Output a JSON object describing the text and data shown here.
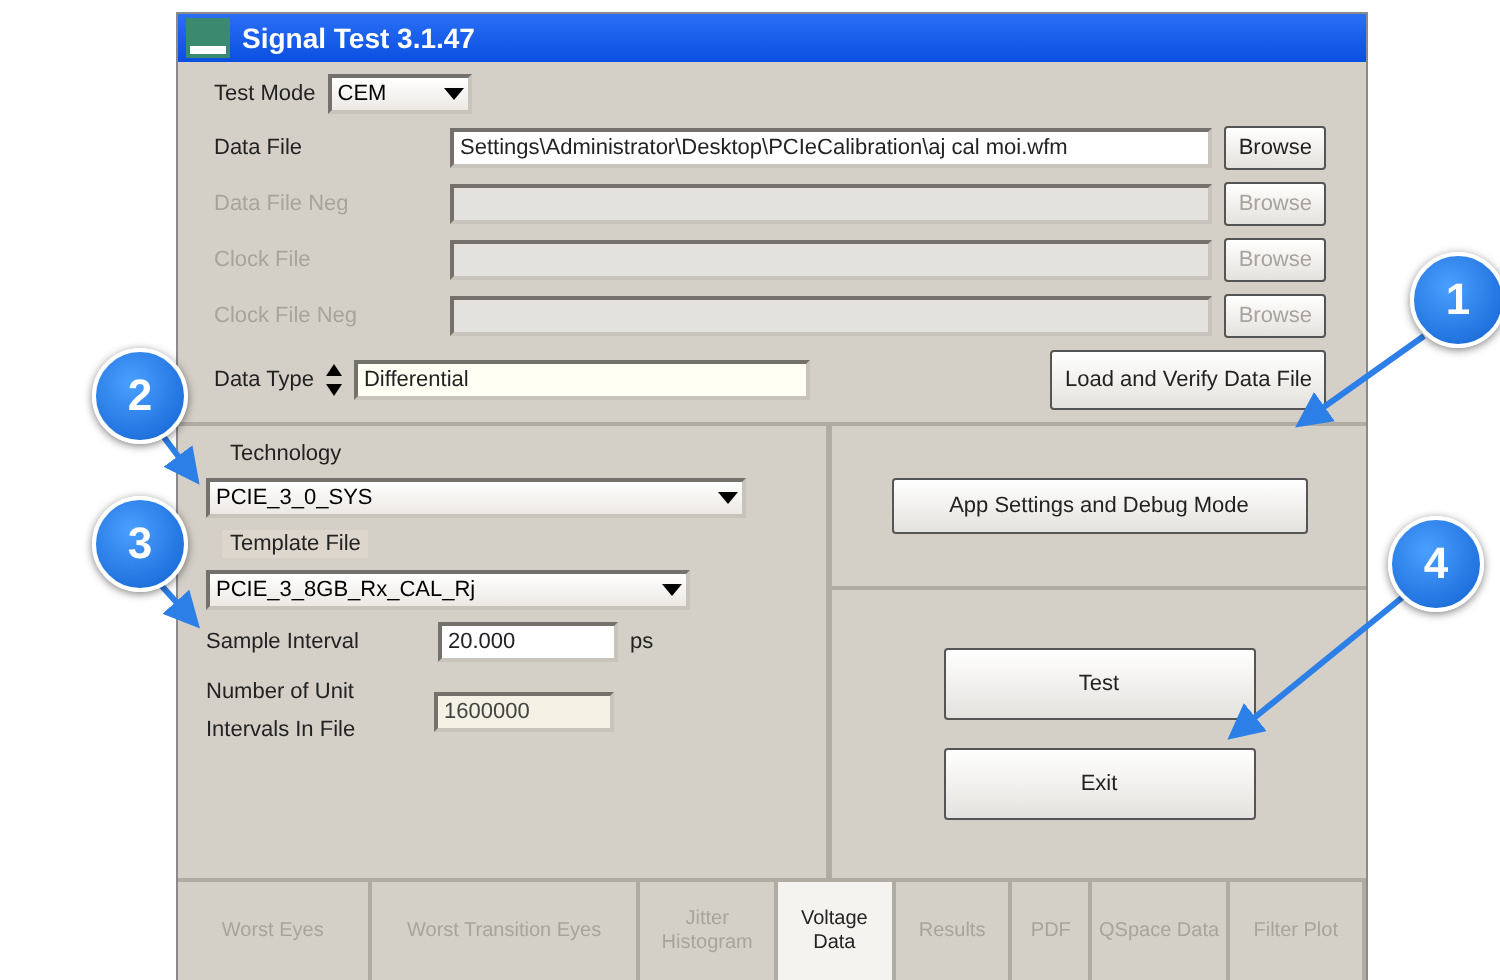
{
  "window": {
    "title": "Signal Test 3.1.47"
  },
  "test_mode": {
    "label": "Test Mode",
    "value": "CEM"
  },
  "file_rows": [
    {
      "label": "Data File",
      "value": "Settings\\Administrator\\Desktop\\PCIeCalibration\\aj cal moi.wfm",
      "disabled": false,
      "button": "Browse"
    },
    {
      "label": "Data File Neg",
      "value": "",
      "disabled": true,
      "button": "Browse"
    },
    {
      "label": "Clock File",
      "value": "",
      "disabled": true,
      "button": "Browse"
    },
    {
      "label": "Clock File Neg",
      "value": "",
      "disabled": true,
      "button": "Browse"
    }
  ],
  "data_type": {
    "label": "Data Type",
    "value": "Differential"
  },
  "load_button": "Load and Verify Data File",
  "technology": {
    "label": "Technology",
    "value": "PCIE_3_0_SYS"
  },
  "template_file": {
    "label": "Template File",
    "value": "PCIE_3_8GB_Rx_CAL_Rj"
  },
  "sample_interval": {
    "label": "Sample Interval",
    "value": "20.000",
    "unit": "ps"
  },
  "unit_intervals": {
    "label": "Number of Unit Intervals In File",
    "value": "1600000"
  },
  "settings_button": "App Settings and Debug Mode",
  "test_button": "Test",
  "exit_button": "Exit",
  "tabs": [
    {
      "label": "Worst Eyes",
      "selected": false
    },
    {
      "label": "Worst Transition Eyes",
      "selected": false
    },
    {
      "label": "Jitter Histogram",
      "selected": false
    },
    {
      "label": "Voltage Data",
      "selected": true
    },
    {
      "label": "Results",
      "selected": false
    },
    {
      "label": "PDF",
      "selected": false
    },
    {
      "label": "QSpace Data",
      "selected": false
    },
    {
      "label": "Filter Plot",
      "selected": false
    }
  ],
  "callouts": [
    {
      "number": "1"
    },
    {
      "number": "2"
    },
    {
      "number": "3"
    },
    {
      "number": "4"
    }
  ]
}
